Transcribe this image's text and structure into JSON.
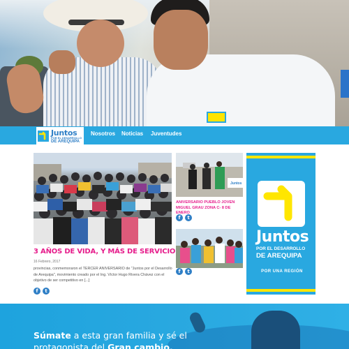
{
  "header": {
    "logo": {
      "title": "Juntos",
      "subtitle": "POR EL DESARROLLO",
      "region": "DE AREQUIPA"
    },
    "nav": [
      "Nosotros",
      "Noticias",
      "Juventudes"
    ]
  },
  "main_article": {
    "title": "3 AÑOS DE VIDA, Y MÁS DE SERVICIO",
    "date": "16 Febrero, 2017",
    "excerpt": "provincias, conmemoraron el TERCER ANIVERSARIO de \"Juntos por el Desarrollo de Arequipa\", movimiento creado por el Ing. Víctor Hugo Rivera Chávez con el objetivo de ser competitivo en [...]",
    "share": [
      "f",
      "t"
    ]
  },
  "side_articles": [
    {
      "title": "ANIVERSARIO PUEBLO JOVEN MIGUEL GRAU ZONA C- 8 DE ENERO",
      "image_sign": "Juntos"
    },
    {
      "title": "",
      "image_sign": ""
    }
  ],
  "banner": {
    "title": "Juntos",
    "subtitle": "POR EL DESARROLLO",
    "region": "DE AREQUIPA",
    "tagline": "POR UNA REGIÓN"
  },
  "footer": {
    "line1_pre": "Súmate",
    "line1_rest": " a esta gran familia y sé el",
    "line2_pre": "protagonista del ",
    "line2_bold": "Gran cambio."
  },
  "colors": {
    "brand_blue": "#29a8e0",
    "brand_yellow": "#ffe600",
    "accent_pink": "#e61e8c",
    "social_blue": "#2f7fc6"
  },
  "icons": [
    "juntos-arrow-icon",
    "facebook-icon",
    "twitter-icon"
  ]
}
